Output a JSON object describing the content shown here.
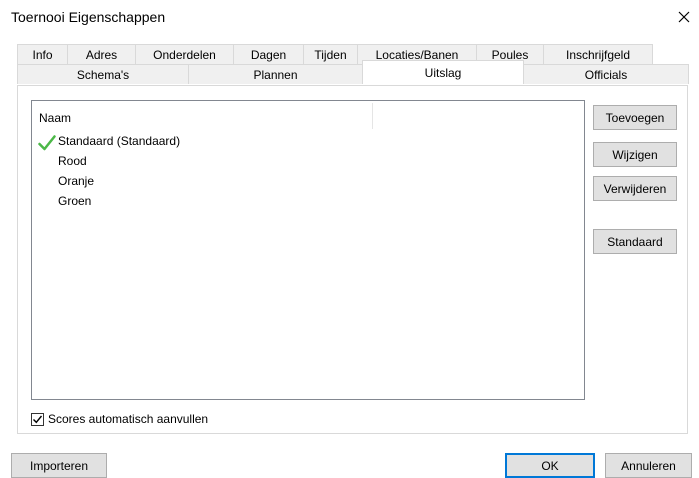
{
  "window": {
    "title": "Toernooi Eigenschappen",
    "close_icon": "close-icon"
  },
  "tabs": {
    "row1": [
      {
        "label": "Info"
      },
      {
        "label": "Adres"
      },
      {
        "label": "Onderdelen"
      },
      {
        "label": "Dagen"
      },
      {
        "label": "Tijden"
      },
      {
        "label": "Locaties/Banen"
      },
      {
        "label": "Poules"
      },
      {
        "label": "Inschrijfgeld"
      }
    ],
    "row2": [
      {
        "label": "Schema's"
      },
      {
        "label": "Plannen"
      },
      {
        "label": "Uitslag"
      },
      {
        "label": "Officials"
      }
    ],
    "active": "Uitslag"
  },
  "list": {
    "column_header": "Naam",
    "items": [
      {
        "label": "Standaard (Standaard)",
        "is_default": true
      },
      {
        "label": "Rood",
        "is_default": false
      },
      {
        "label": "Oranje",
        "is_default": false
      },
      {
        "label": "Groen",
        "is_default": false
      }
    ],
    "check_color": "#4cb848"
  },
  "side_buttons": {
    "add": "Toevoegen",
    "edit": "Wijzigen",
    "delete": "Verwijderen",
    "set_default": "Standaard"
  },
  "checkbox": {
    "label": "Scores automatisch aanvullen",
    "checked": true
  },
  "bottom_buttons": {
    "import": "Importeren",
    "ok": "OK",
    "cancel": "Annuleren"
  }
}
